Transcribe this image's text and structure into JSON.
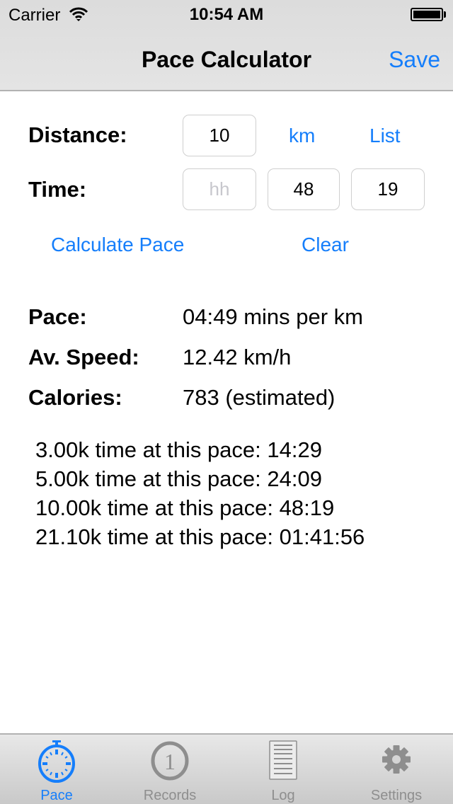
{
  "status_bar": {
    "carrier": "Carrier",
    "time": "10:54 AM",
    "wifi_icon": "wifi-icon",
    "battery_icon": "battery-full-icon"
  },
  "nav": {
    "title": "Pace Calculator",
    "save_label": "Save"
  },
  "form": {
    "distance_label": "Distance:",
    "distance_value": "10",
    "unit_label": "km",
    "list_label": "List",
    "time_label": "Time:",
    "hours_value": "",
    "hours_placeholder": "hh",
    "minutes_value": "48",
    "seconds_value": "19",
    "calculate_label": "Calculate Pace",
    "clear_label": "Clear"
  },
  "results": {
    "pace_label": "Pace:",
    "pace_value": "04:49 mins per km",
    "speed_label": "Av. Speed:",
    "speed_value": "12.42 km/h",
    "calories_label": "Calories:",
    "calories_value": "783 (estimated)"
  },
  "splits": [
    "3.00k time at this pace: 14:29",
    "5.00k time at this pace: 24:09",
    "10.00k time at this pace: 48:19",
    "21.10k time at this pace: 01:41:56"
  ],
  "tabbar": {
    "active": "Pace",
    "tabs": [
      {
        "label": "Pace",
        "icon": "stopwatch-icon"
      },
      {
        "label": "Records",
        "icon": "record-one-icon"
      },
      {
        "label": "Log",
        "icon": "log-list-icon"
      },
      {
        "label": "Settings",
        "icon": "gear-icon"
      }
    ]
  },
  "colors": {
    "accent": "#157efb",
    "inactive_tab": "#8e8e8e"
  }
}
